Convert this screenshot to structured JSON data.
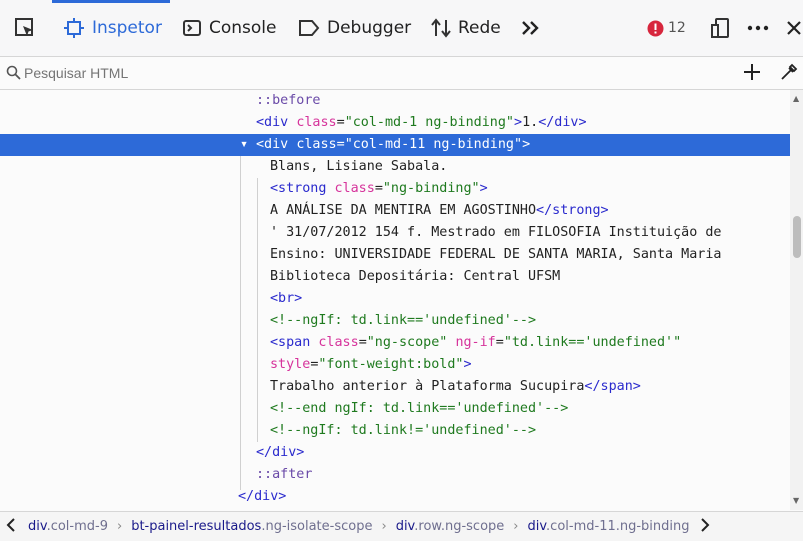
{
  "toolbar": {
    "tabs": [
      {
        "label": "Inspetor"
      },
      {
        "label": "Console"
      },
      {
        "label": "Debugger"
      },
      {
        "label": "Rede"
      }
    ],
    "error_count": "12",
    "colors": {
      "accent": "#2d6ad8",
      "error": "#d7263d"
    }
  },
  "search": {
    "placeholder": "Pesquisar HTML"
  },
  "tree": {
    "l1": "::before",
    "l2": {
      "open": "<div",
      "attr": "class",
      "val": "\"col-md-1 ng-binding\"",
      "text": "1.",
      "close": "</div>"
    },
    "l3": {
      "open": "<div",
      "attr": "class",
      "val": "\"col-md-11 ng-binding\""
    },
    "l4": "Blans, Lisiane Sabala.",
    "l5": {
      "open": "<strong",
      "attr": "class",
      "val": "\"ng-binding\""
    },
    "l6": {
      "text": "A ANÁLISE DA MENTIRA EM AGOSTINHO",
      "close": "</strong>"
    },
    "l7": "' 31/07/2012 154 f. Mestrado em FILOSOFIA Instituição de",
    "l8": "Ensino: UNIVERSIDADE FEDERAL DE SANTA MARIA, Santa Maria",
    "l9": "Biblioteca Depositária: Central UFSM",
    "l10": "<br>",
    "l11": "<!--ngIf: td.link=='undefined'-->",
    "l12": {
      "open": "<span",
      "attr1": "class",
      "val1": "\"ng-scope\"",
      "attr2": "ng-if",
      "val2": "\"td.link=='undefined'\""
    },
    "l13": {
      "attr": "style",
      "val": "\"font-weight:bold\""
    },
    "l14": {
      "text": "Trabalho anterior à Plataforma Sucupira",
      "close": "</span>"
    },
    "l15": "<!--end ngIf: td.link=='undefined'-->",
    "l16": "<!--ngIf: td.link!='undefined'-->",
    "l17": "</div>",
    "l18": "::after",
    "l19": "</div>"
  },
  "breadcrumbs": [
    {
      "tag": "div",
      "cls": ".col-md-9"
    },
    {
      "tag": "bt-painel-resultados",
      "cls": ".ng-isolate-scope"
    },
    {
      "tag": "div",
      "cls": ".row.ng-scope"
    },
    {
      "tag": "div",
      "cls": ".col-md-11.ng-binding"
    }
  ]
}
